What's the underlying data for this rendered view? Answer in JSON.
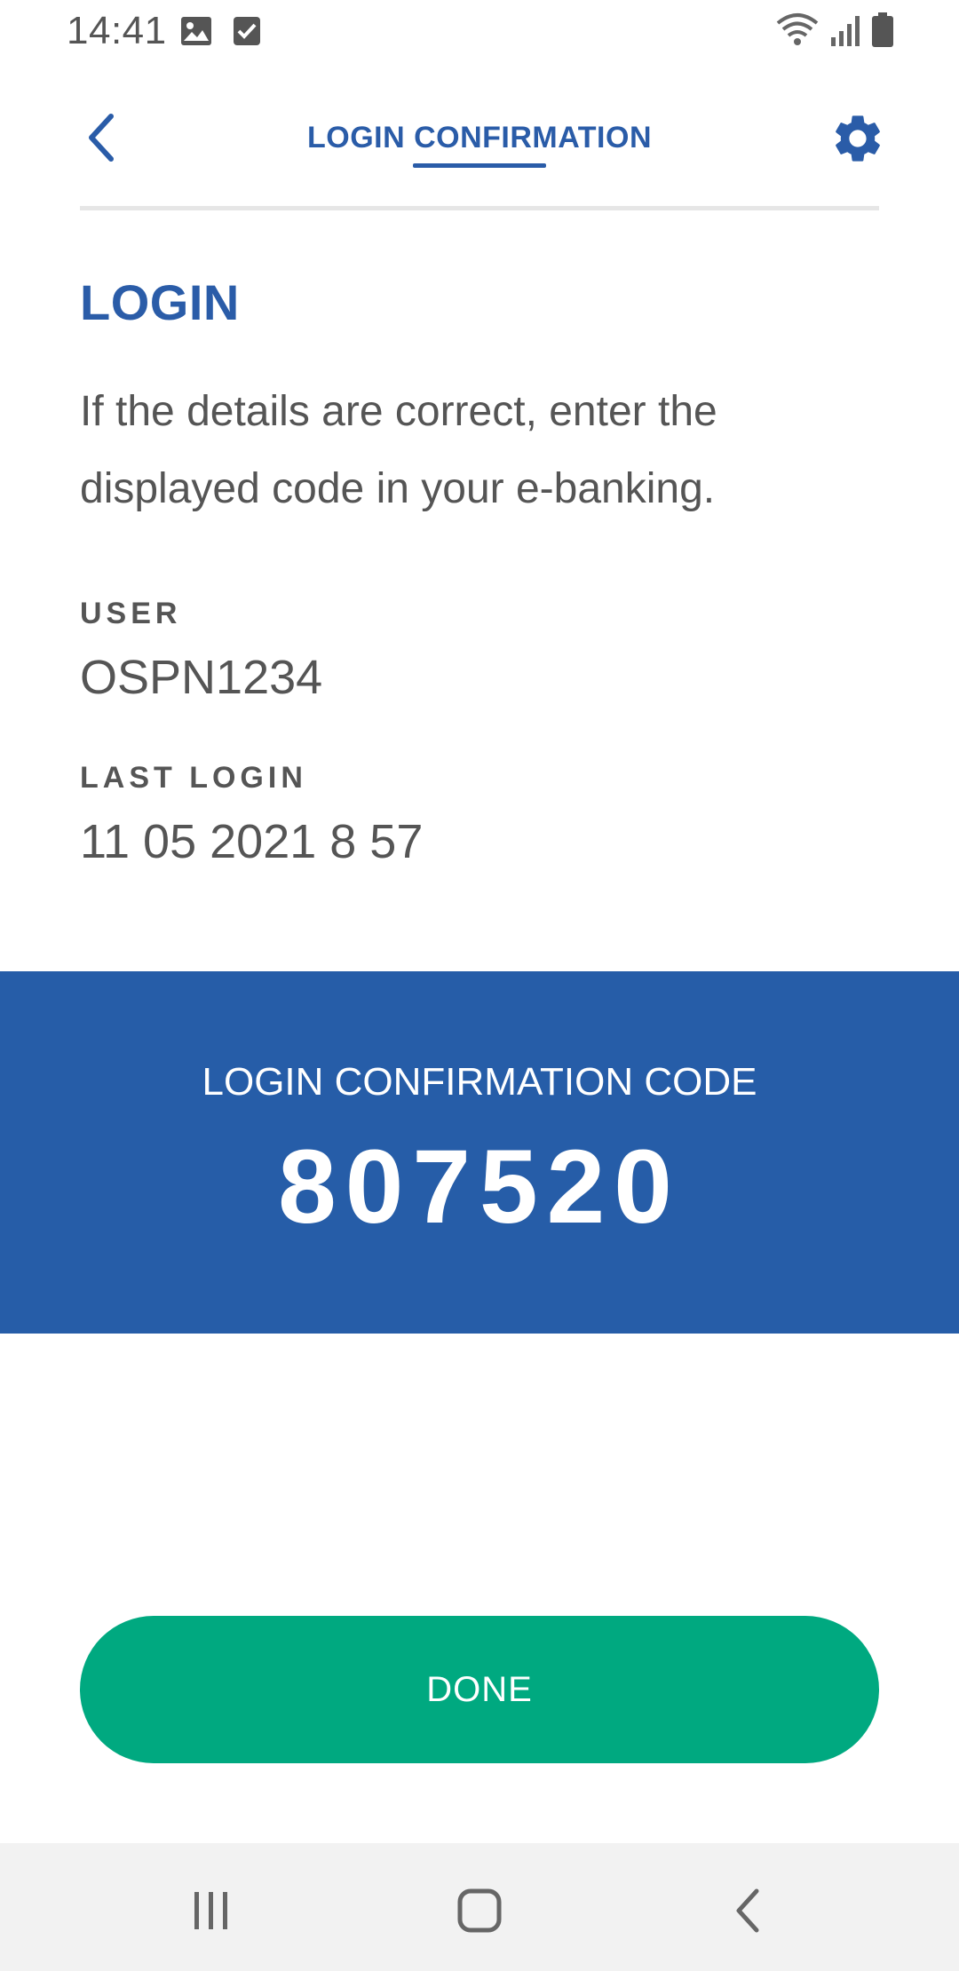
{
  "status_bar": {
    "time": "14:41",
    "icons": [
      "image-icon",
      "checkbox-icon",
      "wifi-icon",
      "signal-icon",
      "battery-icon"
    ]
  },
  "header": {
    "title": "LOGIN CONFIRMATION",
    "back_icon": "chevron-left-icon",
    "settings_icon": "gear-icon"
  },
  "content": {
    "section_title": "LOGIN",
    "description": "If the details are correct, enter the displayed code in your e-banking.",
    "fields": [
      {
        "label": "USER",
        "value": "OSPN1234"
      },
      {
        "label": "LAST LOGIN",
        "value": "11 05 2021 8 57"
      }
    ]
  },
  "code_banner": {
    "label": "LOGIN CONFIRMATION CODE",
    "code": "807520"
  },
  "actions": {
    "done_label": "DONE"
  },
  "nav_bar": {
    "icons": [
      "recents-icon",
      "home-icon",
      "back-icon"
    ]
  },
  "colors": {
    "brand_blue": "#2a5ca8",
    "banner_blue": "#265da8",
    "button_green": "#00a980",
    "text_gray": "#555555"
  }
}
